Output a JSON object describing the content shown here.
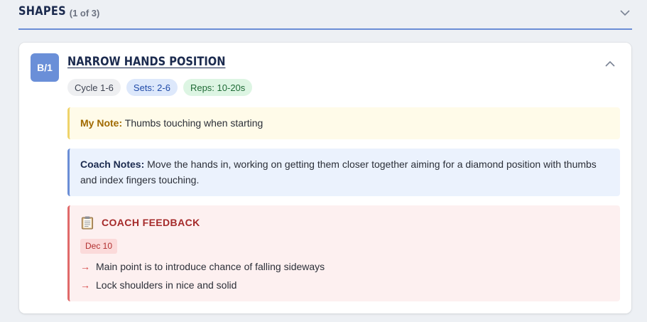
{
  "section": {
    "title": "SHAPES",
    "count": "(1 of 3)"
  },
  "exercise": {
    "id_badge": "B/1",
    "title": "NARROW HANDS POSITION",
    "tags": {
      "cycle": "Cycle 1-6",
      "sets": "Sets: 2-6",
      "reps": "Reps: 10-20s"
    }
  },
  "my_note": {
    "label": "My Note:",
    "text": "Thumbs touching when starting"
  },
  "coach_notes": {
    "label": "Coach Notes:",
    "text": "Move the hands in, working on getting them closer together aiming for a diamond position with thumbs and index fingers touching."
  },
  "coach_feedback": {
    "title": "COACH FEEDBACK",
    "icon": "clipboard-icon",
    "date": "Dec 10",
    "items": [
      {
        "arrow": "→",
        "text": "Main point is to introduce chance of falling sideways"
      },
      {
        "arrow": "→",
        "text": "Lock shoulders in nice and solid"
      }
    ]
  },
  "colors": {
    "accent": "#6b8ed6",
    "feedback_red": "#a52a2a",
    "note_yellow": "#efd36b"
  }
}
